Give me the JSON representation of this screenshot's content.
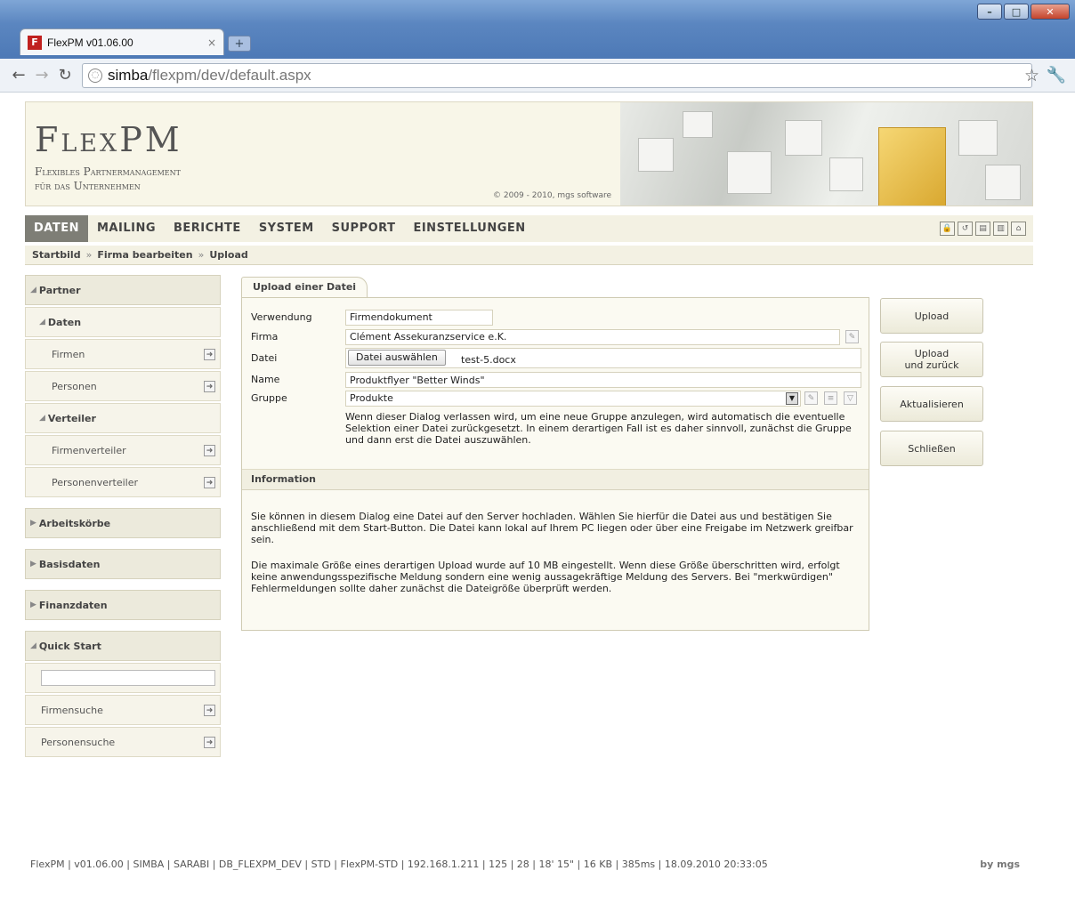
{
  "browser": {
    "tab_title": "FlexPM v01.06.00",
    "tab_close": "×",
    "new_tab": "+",
    "url_host": "simba",
    "url_path": "/flexpm/dev/default.aspx",
    "favicon_letter": "F"
  },
  "header": {
    "logo": "FlexPM",
    "tagline1": "Flexibles Partnermanagement",
    "tagline2": "für das Unternehmen",
    "copyright": "© 2009 - 2010, mgs software"
  },
  "menu": {
    "items": [
      "DATEN",
      "MAILING",
      "BERICHTE",
      "SYSTEM",
      "SUPPORT",
      "EINSTELLUNGEN"
    ],
    "active": "DATEN"
  },
  "breadcrumb": [
    "Startbild",
    "Firma bearbeiten",
    "Upload"
  ],
  "breadcrumb_sep": "»",
  "sidebar": {
    "partner": "Partner",
    "daten": "Daten",
    "firmen": "Firmen",
    "personen": "Personen",
    "verteiler": "Verteiler",
    "firmenverteiler": "Firmenverteiler",
    "personenverteiler": "Personenverteiler",
    "arbeitskoerbe": "Arbeitskörbe",
    "basisdaten": "Basisdaten",
    "finanzdaten": "Finanzdaten",
    "quickstart": "Quick Start",
    "firmensuche": "Firmensuche",
    "personensuche": "Personensuche"
  },
  "dialog": {
    "tab": "Upload einer Datei",
    "labels": {
      "verwendung": "Verwendung",
      "firma": "Firma",
      "datei": "Datei",
      "name": "Name",
      "gruppe": "Gruppe"
    },
    "values": {
      "verwendung": "Firmendokument",
      "firma": "Clément Assekuranzservice e.K.",
      "datei_button": "Datei auswählen",
      "datei_file": "test-5.docx",
      "name": "Produktflyer \"Better Winds\"",
      "gruppe": "Produkte"
    },
    "hint": "Wenn dieser Dialog verlassen wird, um eine neue Gruppe anzulegen, wird automatisch die eventuelle Selektion einer Datei zurückgesetzt. In einem derartigen Fall ist es daher sinnvoll, zunächst die Gruppe und dann erst die Datei auszuwählen.",
    "info_title": "Information",
    "info_p1": "Sie können in diesem Dialog eine Datei auf den Server hochladen. Wählen Sie hierfür die Datei aus und bestätigen Sie anschließend mit dem Start-Button. Die Datei kann lokal auf Ihrem PC liegen oder über eine Freigabe im Netzwerk greifbar sein.",
    "info_p2": "Die maximale Größe eines derartigen Upload wurde auf 10 MB eingestellt. Wenn diese Größe überschritten wird, erfolgt keine anwendungsspezifische Meldung sondern eine wenig aussagekräftige Meldung des Servers. Bei \"merkwürdigen\" Fehlermeldungen sollte daher zunächst die Dateigröße überprüft werden."
  },
  "actions": {
    "upload": "Upload",
    "upload_back": "Upload\nund zurück",
    "refresh": "Aktualisieren",
    "close": "Schließen"
  },
  "footer": {
    "status": "FlexPM | v01.06.00 | SIMBA | SARABI | DB_FLEXPM_DEV | STD | FlexPM-STD | 192.168.1.211 | 125 | 28 | 18' 15\" | 16 KB | 385ms | 18.09.2010 20:33:05",
    "by": "by mgs"
  }
}
